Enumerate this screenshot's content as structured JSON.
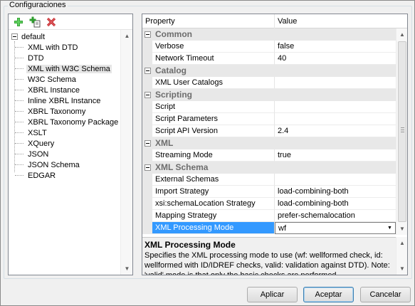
{
  "window": {
    "group_title": "Configuraciones"
  },
  "toolbar": {
    "add_icon": "add-plus-icon",
    "duplicate_icon": "duplicate-plus-icon",
    "delete_icon": "delete-x-icon"
  },
  "tree": {
    "root": "default",
    "items": [
      {
        "label": "XML with DTD"
      },
      {
        "label": "DTD"
      },
      {
        "label": "XML with W3C Schema",
        "selected": true
      },
      {
        "label": "W3C Schema"
      },
      {
        "label": "XBRL Instance"
      },
      {
        "label": "Inline XBRL Instance"
      },
      {
        "label": "XBRL Taxonomy"
      },
      {
        "label": "XBRL Taxonomy Package"
      },
      {
        "label": "XSLT"
      },
      {
        "label": "XQuery"
      },
      {
        "label": "JSON"
      },
      {
        "label": "JSON Schema"
      },
      {
        "label": "EDGAR"
      }
    ]
  },
  "grid": {
    "col_property": "Property",
    "col_value": "Value",
    "rows": [
      {
        "type": "cat",
        "label": "Common"
      },
      {
        "type": "prop",
        "name": "Verbose",
        "value": "false"
      },
      {
        "type": "prop",
        "name": "Network Timeout",
        "value": "40"
      },
      {
        "type": "cat",
        "label": "Catalog"
      },
      {
        "type": "prop",
        "name": "XML User Catalogs",
        "value": ""
      },
      {
        "type": "cat",
        "label": "Scripting"
      },
      {
        "type": "prop",
        "name": "Script",
        "value": ""
      },
      {
        "type": "prop",
        "name": "Script Parameters",
        "value": ""
      },
      {
        "type": "prop",
        "name": "Script API Version",
        "value": "2.4"
      },
      {
        "type": "cat",
        "label": "XML"
      },
      {
        "type": "prop",
        "name": "Streaming Mode",
        "value": "true"
      },
      {
        "type": "cat",
        "label": "XML Schema"
      },
      {
        "type": "prop",
        "name": "External Schemas",
        "value": ""
      },
      {
        "type": "prop",
        "name": "Import Strategy",
        "value": "load-combining-both"
      },
      {
        "type": "prop",
        "name": "xsi:schemaLocation Strategy",
        "value": "load-combining-both"
      },
      {
        "type": "prop",
        "name": "Mapping Strategy",
        "value": "prefer-schemalocation"
      },
      {
        "type": "prop",
        "name": "XML Processing Mode",
        "value": "wf",
        "selected": true
      }
    ]
  },
  "description": {
    "title": "XML Processing Mode",
    "text": "Specifies the XML processing mode to use (wf: wellformed check, id: wellformed with ID/IDREF checks, valid: validation against DTD). Note: 'valid' mode is that only the basic checks are performed."
  },
  "buttons": {
    "apply": "Aplicar",
    "accept": "Aceptar",
    "cancel": "Cancelar"
  }
}
